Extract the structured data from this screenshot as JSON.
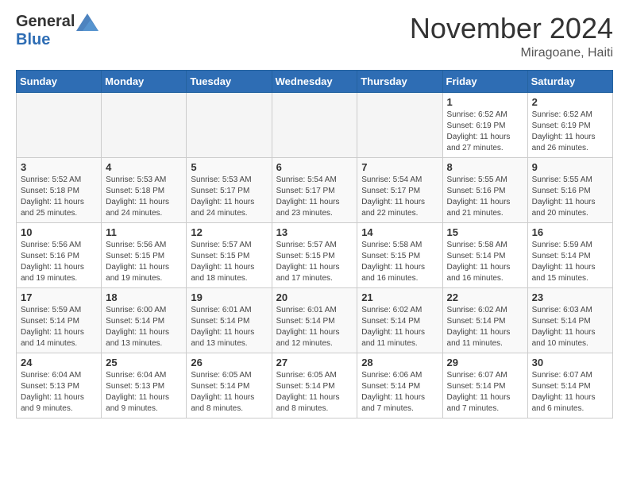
{
  "logo": {
    "general": "General",
    "blue": "Blue"
  },
  "header": {
    "month": "November 2024",
    "location": "Miragoane, Haiti"
  },
  "weekdays": [
    "Sunday",
    "Monday",
    "Tuesday",
    "Wednesday",
    "Thursday",
    "Friday",
    "Saturday"
  ],
  "weeks": [
    [
      {
        "day": "",
        "info": ""
      },
      {
        "day": "",
        "info": ""
      },
      {
        "day": "",
        "info": ""
      },
      {
        "day": "",
        "info": ""
      },
      {
        "day": "",
        "info": ""
      },
      {
        "day": "1",
        "info": "Sunrise: 6:52 AM\nSunset: 6:19 PM\nDaylight: 11 hours and 27 minutes."
      },
      {
        "day": "2",
        "info": "Sunrise: 6:52 AM\nSunset: 6:19 PM\nDaylight: 11 hours and 26 minutes."
      }
    ],
    [
      {
        "day": "3",
        "info": "Sunrise: 5:52 AM\nSunset: 5:18 PM\nDaylight: 11 hours and 25 minutes."
      },
      {
        "day": "4",
        "info": "Sunrise: 5:53 AM\nSunset: 5:18 PM\nDaylight: 11 hours and 24 minutes."
      },
      {
        "day": "5",
        "info": "Sunrise: 5:53 AM\nSunset: 5:17 PM\nDaylight: 11 hours and 24 minutes."
      },
      {
        "day": "6",
        "info": "Sunrise: 5:54 AM\nSunset: 5:17 PM\nDaylight: 11 hours and 23 minutes."
      },
      {
        "day": "7",
        "info": "Sunrise: 5:54 AM\nSunset: 5:17 PM\nDaylight: 11 hours and 22 minutes."
      },
      {
        "day": "8",
        "info": "Sunrise: 5:55 AM\nSunset: 5:16 PM\nDaylight: 11 hours and 21 minutes."
      },
      {
        "day": "9",
        "info": "Sunrise: 5:55 AM\nSunset: 5:16 PM\nDaylight: 11 hours and 20 minutes."
      }
    ],
    [
      {
        "day": "10",
        "info": "Sunrise: 5:56 AM\nSunset: 5:16 PM\nDaylight: 11 hours and 19 minutes."
      },
      {
        "day": "11",
        "info": "Sunrise: 5:56 AM\nSunset: 5:15 PM\nDaylight: 11 hours and 19 minutes."
      },
      {
        "day": "12",
        "info": "Sunrise: 5:57 AM\nSunset: 5:15 PM\nDaylight: 11 hours and 18 minutes."
      },
      {
        "day": "13",
        "info": "Sunrise: 5:57 AM\nSunset: 5:15 PM\nDaylight: 11 hours and 17 minutes."
      },
      {
        "day": "14",
        "info": "Sunrise: 5:58 AM\nSunset: 5:15 PM\nDaylight: 11 hours and 16 minutes."
      },
      {
        "day": "15",
        "info": "Sunrise: 5:58 AM\nSunset: 5:14 PM\nDaylight: 11 hours and 16 minutes."
      },
      {
        "day": "16",
        "info": "Sunrise: 5:59 AM\nSunset: 5:14 PM\nDaylight: 11 hours and 15 minutes."
      }
    ],
    [
      {
        "day": "17",
        "info": "Sunrise: 5:59 AM\nSunset: 5:14 PM\nDaylight: 11 hours and 14 minutes."
      },
      {
        "day": "18",
        "info": "Sunrise: 6:00 AM\nSunset: 5:14 PM\nDaylight: 11 hours and 13 minutes."
      },
      {
        "day": "19",
        "info": "Sunrise: 6:01 AM\nSunset: 5:14 PM\nDaylight: 11 hours and 13 minutes."
      },
      {
        "day": "20",
        "info": "Sunrise: 6:01 AM\nSunset: 5:14 PM\nDaylight: 11 hours and 12 minutes."
      },
      {
        "day": "21",
        "info": "Sunrise: 6:02 AM\nSunset: 5:14 PM\nDaylight: 11 hours and 11 minutes."
      },
      {
        "day": "22",
        "info": "Sunrise: 6:02 AM\nSunset: 5:14 PM\nDaylight: 11 hours and 11 minutes."
      },
      {
        "day": "23",
        "info": "Sunrise: 6:03 AM\nSunset: 5:14 PM\nDaylight: 11 hours and 10 minutes."
      }
    ],
    [
      {
        "day": "24",
        "info": "Sunrise: 6:04 AM\nSunset: 5:13 PM\nDaylight: 11 hours and 9 minutes."
      },
      {
        "day": "25",
        "info": "Sunrise: 6:04 AM\nSunset: 5:13 PM\nDaylight: 11 hours and 9 minutes."
      },
      {
        "day": "26",
        "info": "Sunrise: 6:05 AM\nSunset: 5:14 PM\nDaylight: 11 hours and 8 minutes."
      },
      {
        "day": "27",
        "info": "Sunrise: 6:05 AM\nSunset: 5:14 PM\nDaylight: 11 hours and 8 minutes."
      },
      {
        "day": "28",
        "info": "Sunrise: 6:06 AM\nSunset: 5:14 PM\nDaylight: 11 hours and 7 minutes."
      },
      {
        "day": "29",
        "info": "Sunrise: 6:07 AM\nSunset: 5:14 PM\nDaylight: 11 hours and 7 minutes."
      },
      {
        "day": "30",
        "info": "Sunrise: 6:07 AM\nSunset: 5:14 PM\nDaylight: 11 hours and 6 minutes."
      }
    ]
  ]
}
